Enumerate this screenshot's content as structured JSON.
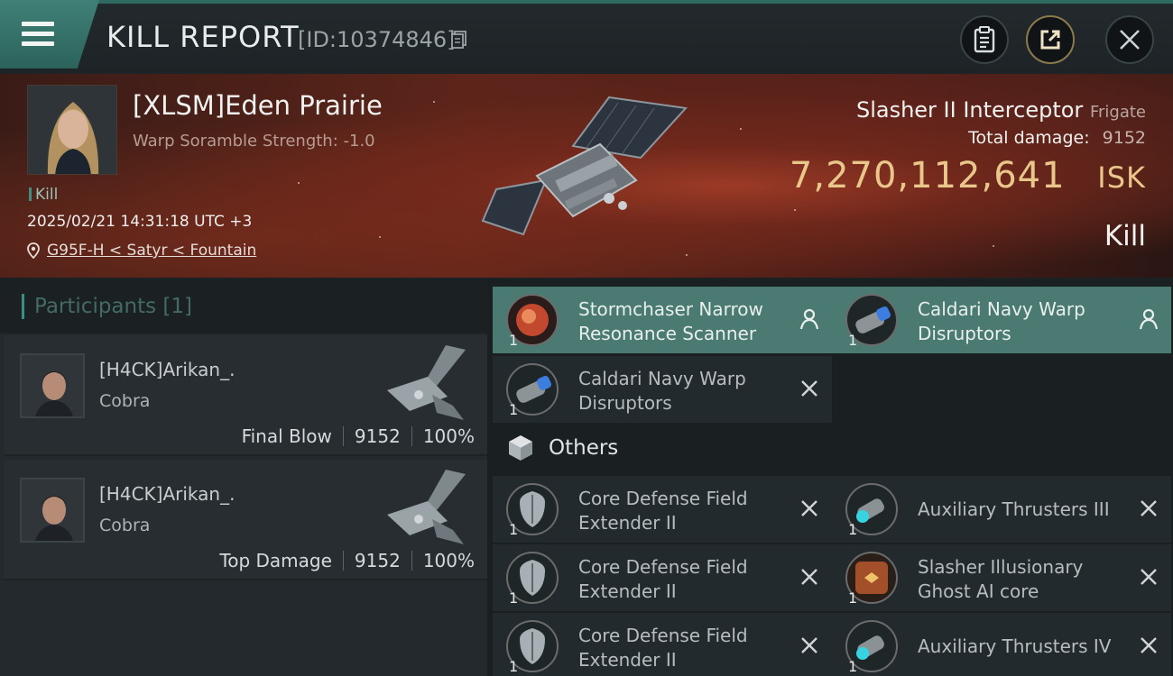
{
  "header": {
    "title": "KILL REPORT",
    "report_id": "[ID:10374846]"
  },
  "victim": {
    "name": "[XLSM]Eden Prairie",
    "subtitle": "Warp Soramble Strength: -1.0",
    "tag": "Kill",
    "datetime": "2025/02/21 14:31:18 UTC +3",
    "location": "G95F-H < Satyr < Fountain",
    "ship_name": "Slasher II Interceptor",
    "ship_class": "Frigate",
    "total_damage_label": "Total damage:",
    "total_damage": "9152",
    "isk_value": "7,270,112,641",
    "isk_unit": "ISK",
    "result": "Kill"
  },
  "participants": {
    "title": "Participants",
    "count": "[1]",
    "rows": [
      {
        "name": "[H4CK]Arikan_.",
        "ship": "Cobra",
        "role": "Final Blow",
        "damage": "9152",
        "percent": "100%"
      },
      {
        "name": "[H4CK]Arikan_.",
        "ship": "Cobra",
        "role": "Top Damage",
        "damage": "9152",
        "percent": "100%"
      }
    ]
  },
  "items": {
    "top": [
      {
        "name": "Stormchaser Narrow Resonance Scanner",
        "qty": "1",
        "status": "dropped"
      },
      {
        "name": "Caldari Navy Warp Disruptors",
        "qty": "1",
        "status": "dropped"
      },
      {
        "name": "Caldari Navy Warp Disruptors",
        "qty": "1",
        "status": "destroyed"
      }
    ],
    "others_label": "Others",
    "others": [
      {
        "name": "Core Defense Field Extender II",
        "qty": "1",
        "tier": "II"
      },
      {
        "name": "Auxiliary Thrusters III",
        "qty": "1",
        "tier": "III"
      },
      {
        "name": "Core Defense Field Extender II",
        "qty": "1",
        "tier": "II"
      },
      {
        "name": "Slasher Illusionary Ghost AI core",
        "qty": "1",
        "tier": ""
      },
      {
        "name": "Core Defense Field Extender II",
        "qty": "1",
        "tier": "II"
      },
      {
        "name": "Auxiliary Thrusters IV",
        "qty": "1",
        "tier": "IV"
      }
    ]
  },
  "colors": {
    "accent": "#3d8f82",
    "isk": "#e9c78a",
    "dropped_bg": "#4a7a72"
  }
}
